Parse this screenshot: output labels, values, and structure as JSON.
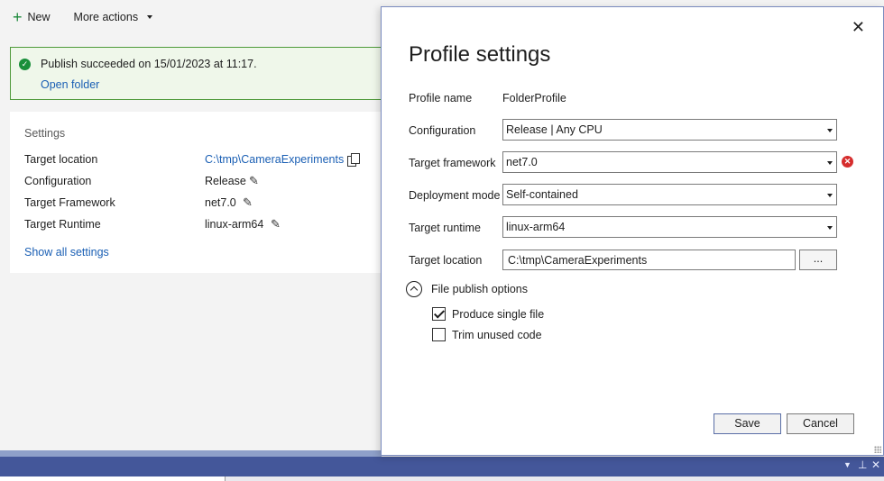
{
  "toolbar": {
    "new_label": "New",
    "more_actions_label": "More actions"
  },
  "publish_status": {
    "message": "Publish succeeded on 15/01/2023 at 11:17.",
    "open_folder": "Open folder"
  },
  "settings": {
    "title": "Settings",
    "rows": [
      {
        "label": "Target location",
        "value": "C:\\tmp\\CameraExperiments"
      },
      {
        "label": "Configuration",
        "value": "Release"
      },
      {
        "label": "Target Framework",
        "value": "net7.0"
      },
      {
        "label": "Target Runtime",
        "value": "linux-arm64"
      }
    ],
    "show_all": "Show all settings"
  },
  "dialog": {
    "title": "Profile settings",
    "close_glyph": "✕",
    "profile_name": {
      "label": "Profile name",
      "value": "FolderProfile"
    },
    "configuration": {
      "label": "Configuration",
      "value": "Release | Any CPU"
    },
    "target_framework": {
      "label": "Target framework",
      "value": "net7.0"
    },
    "deployment_mode": {
      "label": "Deployment mode",
      "value": "Self-contained"
    },
    "target_runtime": {
      "label": "Target runtime",
      "value": "linux-arm64"
    },
    "target_location": {
      "label": "Target location",
      "value": "C:\\tmp\\CameraExperiments",
      "browse_label": "..."
    },
    "file_publish_options": {
      "label": "File publish options",
      "produce_single_file": {
        "label": "Produce single file",
        "checked": true
      },
      "trim_unused_code": {
        "label": "Trim unused code",
        "checked": false
      }
    },
    "save_label": "Save",
    "cancel_label": "Cancel"
  },
  "icons": {
    "new": "plus-icon",
    "success": "check-circle-icon",
    "copy": "copy-icon",
    "edit": "pencil-icon",
    "error": "error-circle-icon",
    "close": "close-icon"
  },
  "colors": {
    "link": "#1a5fb4",
    "success_border": "#4e9a3a",
    "success_bg": "#eff7ea",
    "error": "#d62d2d",
    "dock_bar": "#44579a"
  }
}
